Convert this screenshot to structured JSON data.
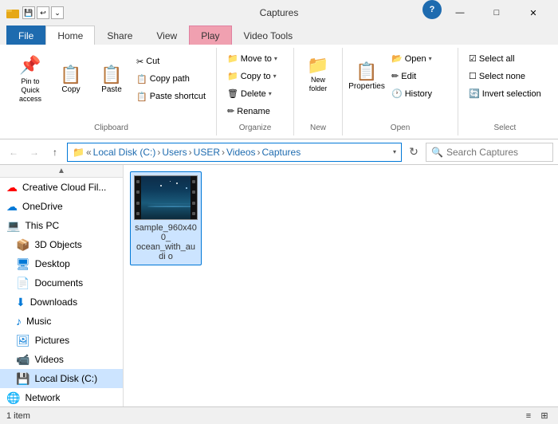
{
  "window": {
    "title": "Captures",
    "help_symbol": "?",
    "minimize": "—",
    "maximize": "□",
    "close": "✕"
  },
  "tabs": [
    {
      "id": "file",
      "label": "File"
    },
    {
      "id": "home",
      "label": "Home"
    },
    {
      "id": "share",
      "label": "Share"
    },
    {
      "id": "view",
      "label": "View"
    },
    {
      "id": "play",
      "label": "Play"
    },
    {
      "id": "video_tools",
      "label": "Video Tools"
    }
  ],
  "ribbon": {
    "clipboard": {
      "label": "Clipboard",
      "pin_label": "Pin to Quick\naccess",
      "copy_label": "Copy",
      "paste_label": "Paste",
      "cut": "Cut",
      "copy_path": "Copy path",
      "paste_shortcut": "Paste shortcut"
    },
    "organize": {
      "label": "Organize",
      "move_to": "Move to",
      "copy_to": "Copy to",
      "delete": "Delete",
      "rename": "Rename"
    },
    "new": {
      "label": "New",
      "new_folder": "New\nfolder"
    },
    "open": {
      "label": "Open",
      "open": "Open",
      "edit": "Edit",
      "history": "History",
      "properties": "Properties"
    },
    "select": {
      "label": "Select",
      "select_all": "Select all",
      "select_none": "Select none",
      "invert": "Invert selection"
    }
  },
  "address_bar": {
    "path_parts": [
      "Local Disk (C:)",
      "Users",
      "USER",
      "Videos",
      "Captures"
    ],
    "search_placeholder": "Search Captures"
  },
  "sidebar": {
    "items": [
      {
        "id": "creative-cloud",
        "label": "Creative Cloud Fil...",
        "icon": "🔴",
        "indent": 0
      },
      {
        "id": "onedrive",
        "label": "OneDrive",
        "icon": "☁",
        "indent": 0
      },
      {
        "id": "this-pc",
        "label": "This PC",
        "icon": "💻",
        "indent": 0
      },
      {
        "id": "3d-objects",
        "label": "3D Objects",
        "icon": "📦",
        "indent": 1
      },
      {
        "id": "desktop",
        "label": "Desktop",
        "icon": "🖥",
        "indent": 1
      },
      {
        "id": "documents",
        "label": "Documents",
        "icon": "📄",
        "indent": 1
      },
      {
        "id": "downloads",
        "label": "Downloads",
        "icon": "⬇",
        "indent": 1
      },
      {
        "id": "music",
        "label": "Music",
        "icon": "♪",
        "indent": 1
      },
      {
        "id": "pictures",
        "label": "Pictures",
        "icon": "🖼",
        "indent": 1
      },
      {
        "id": "videos",
        "label": "Videos",
        "icon": "📹",
        "indent": 1
      },
      {
        "id": "local-disk",
        "label": "Local Disk (C:)",
        "icon": "💾",
        "indent": 1,
        "selected": true
      },
      {
        "id": "network",
        "label": "Network",
        "icon": "🌐",
        "indent": 0
      }
    ]
  },
  "files": [
    {
      "id": "ocean-video",
      "name": "sample_960x400_\nocean_with_audi\no",
      "type": "video",
      "selected": true
    }
  ],
  "status_bar": {
    "item_count": "1 item"
  }
}
